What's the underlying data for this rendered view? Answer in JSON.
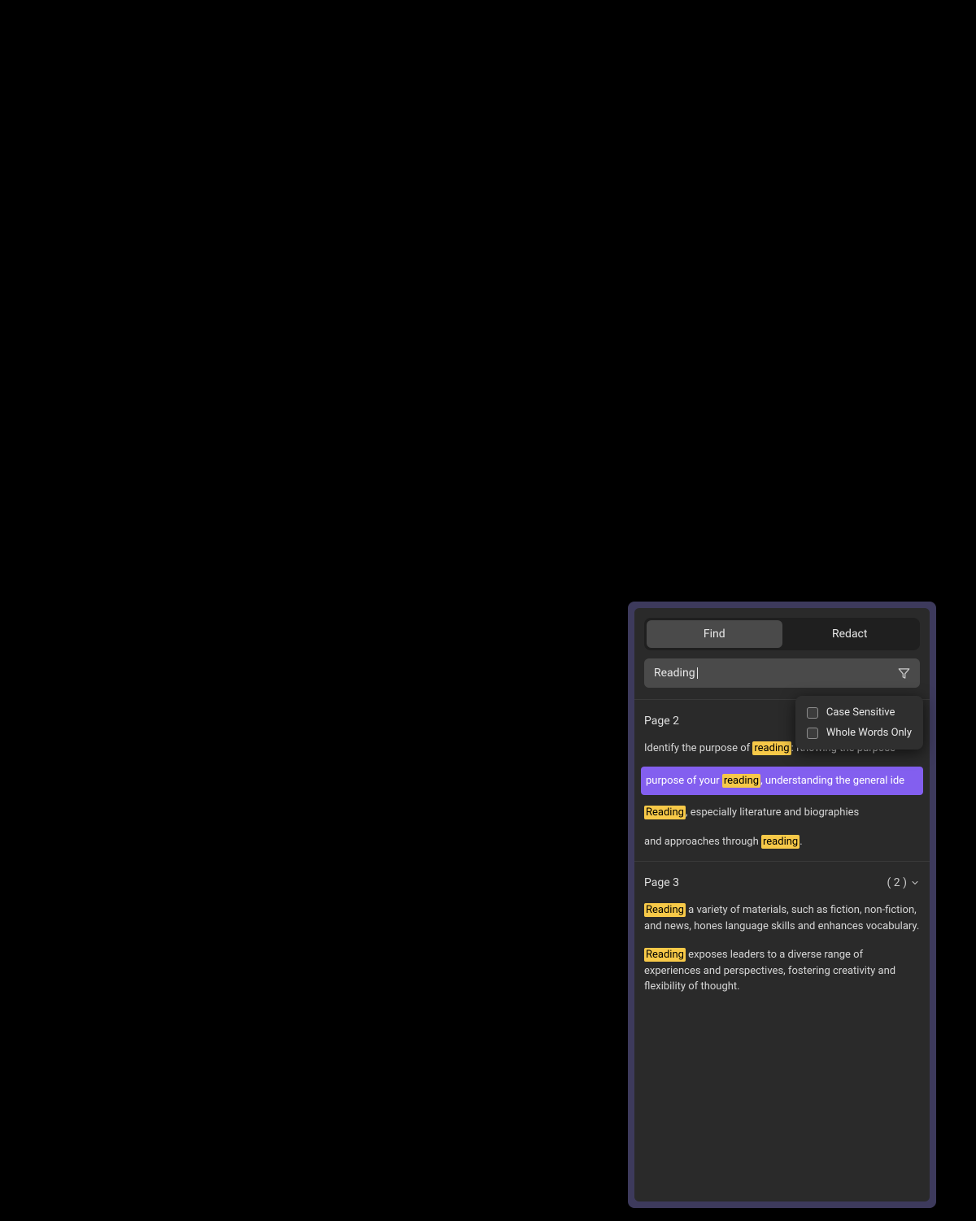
{
  "tabs": {
    "find": "Find",
    "redact": "Redact"
  },
  "search": {
    "value": "Reading"
  },
  "filters": {
    "case_sensitive": "Case Sensitive",
    "whole_words": "Whole Words Only"
  },
  "pages": [
    {
      "label": "Page 2",
      "count": "",
      "results": [
        {
          "pre": "Identify the purpose of ",
          "match": "reading",
          "post": ": Knowing the purpose",
          "selected": false
        },
        {
          "pre": "purpose of your ",
          "match": "reading",
          "post": ", understanding the general ide",
          "selected": true
        },
        {
          "pre": "",
          "match": "Reading",
          "post": ", especially literature and biographies",
          "selected": false
        },
        {
          "pre": "and approaches through ",
          "match": "reading",
          "post": ".",
          "selected": false
        }
      ]
    },
    {
      "label": "Page 3",
      "count": "( 2 )",
      "results": [
        {
          "pre": "",
          "match": "Reading",
          "post": " a variety of materials, such as fiction, non-fiction, and news, hones language skills and enhances vocabulary.",
          "selected": false
        },
        {
          "pre": "",
          "match": "Reading",
          "post": " exposes leaders to a diverse range of experiences and perspectives, fostering creativity and flexibility of thought.",
          "selected": false
        }
      ]
    }
  ]
}
